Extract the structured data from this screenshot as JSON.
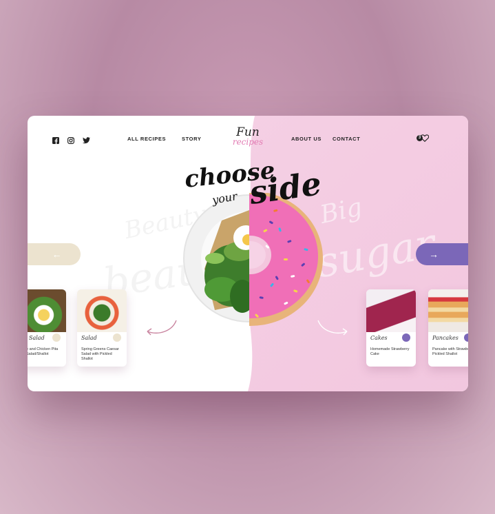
{
  "social": [
    "facebook-icon",
    "instagram-icon",
    "twitter-icon"
  ],
  "nav": {
    "all_recipes": "ALL RECIPES",
    "story": "STORY",
    "about": "ABOUT US",
    "contact": "CONTACT"
  },
  "logo": {
    "line1": "Fun",
    "line2": "recipes"
  },
  "favorites": {
    "count": "3"
  },
  "headline": {
    "word1": "choose",
    "word2": "your",
    "word3": "side"
  },
  "background_words": {
    "left1": "Beauty",
    "left2": "beauty",
    "right1": "Big",
    "right2": "sugar"
  },
  "colors": {
    "pink": "#f2c7df",
    "purple": "#7b67b8",
    "beige": "#ece3cf",
    "logo_pink": "#e27bb3"
  },
  "healthy_cards": [
    {
      "tag": "Salad",
      "title": "e and Chicken Pita Salad/Shallot"
    },
    {
      "tag": "Salad",
      "title": "Spring Greens Caesar Salad with Pickled Shallot"
    }
  ],
  "sweet_cards": [
    {
      "tag": "Cakes",
      "title": "Homemade Strawberry Cake"
    },
    {
      "tag": "Pancakes",
      "title": "Pancake with Strawberry Pickled Shallot"
    }
  ]
}
